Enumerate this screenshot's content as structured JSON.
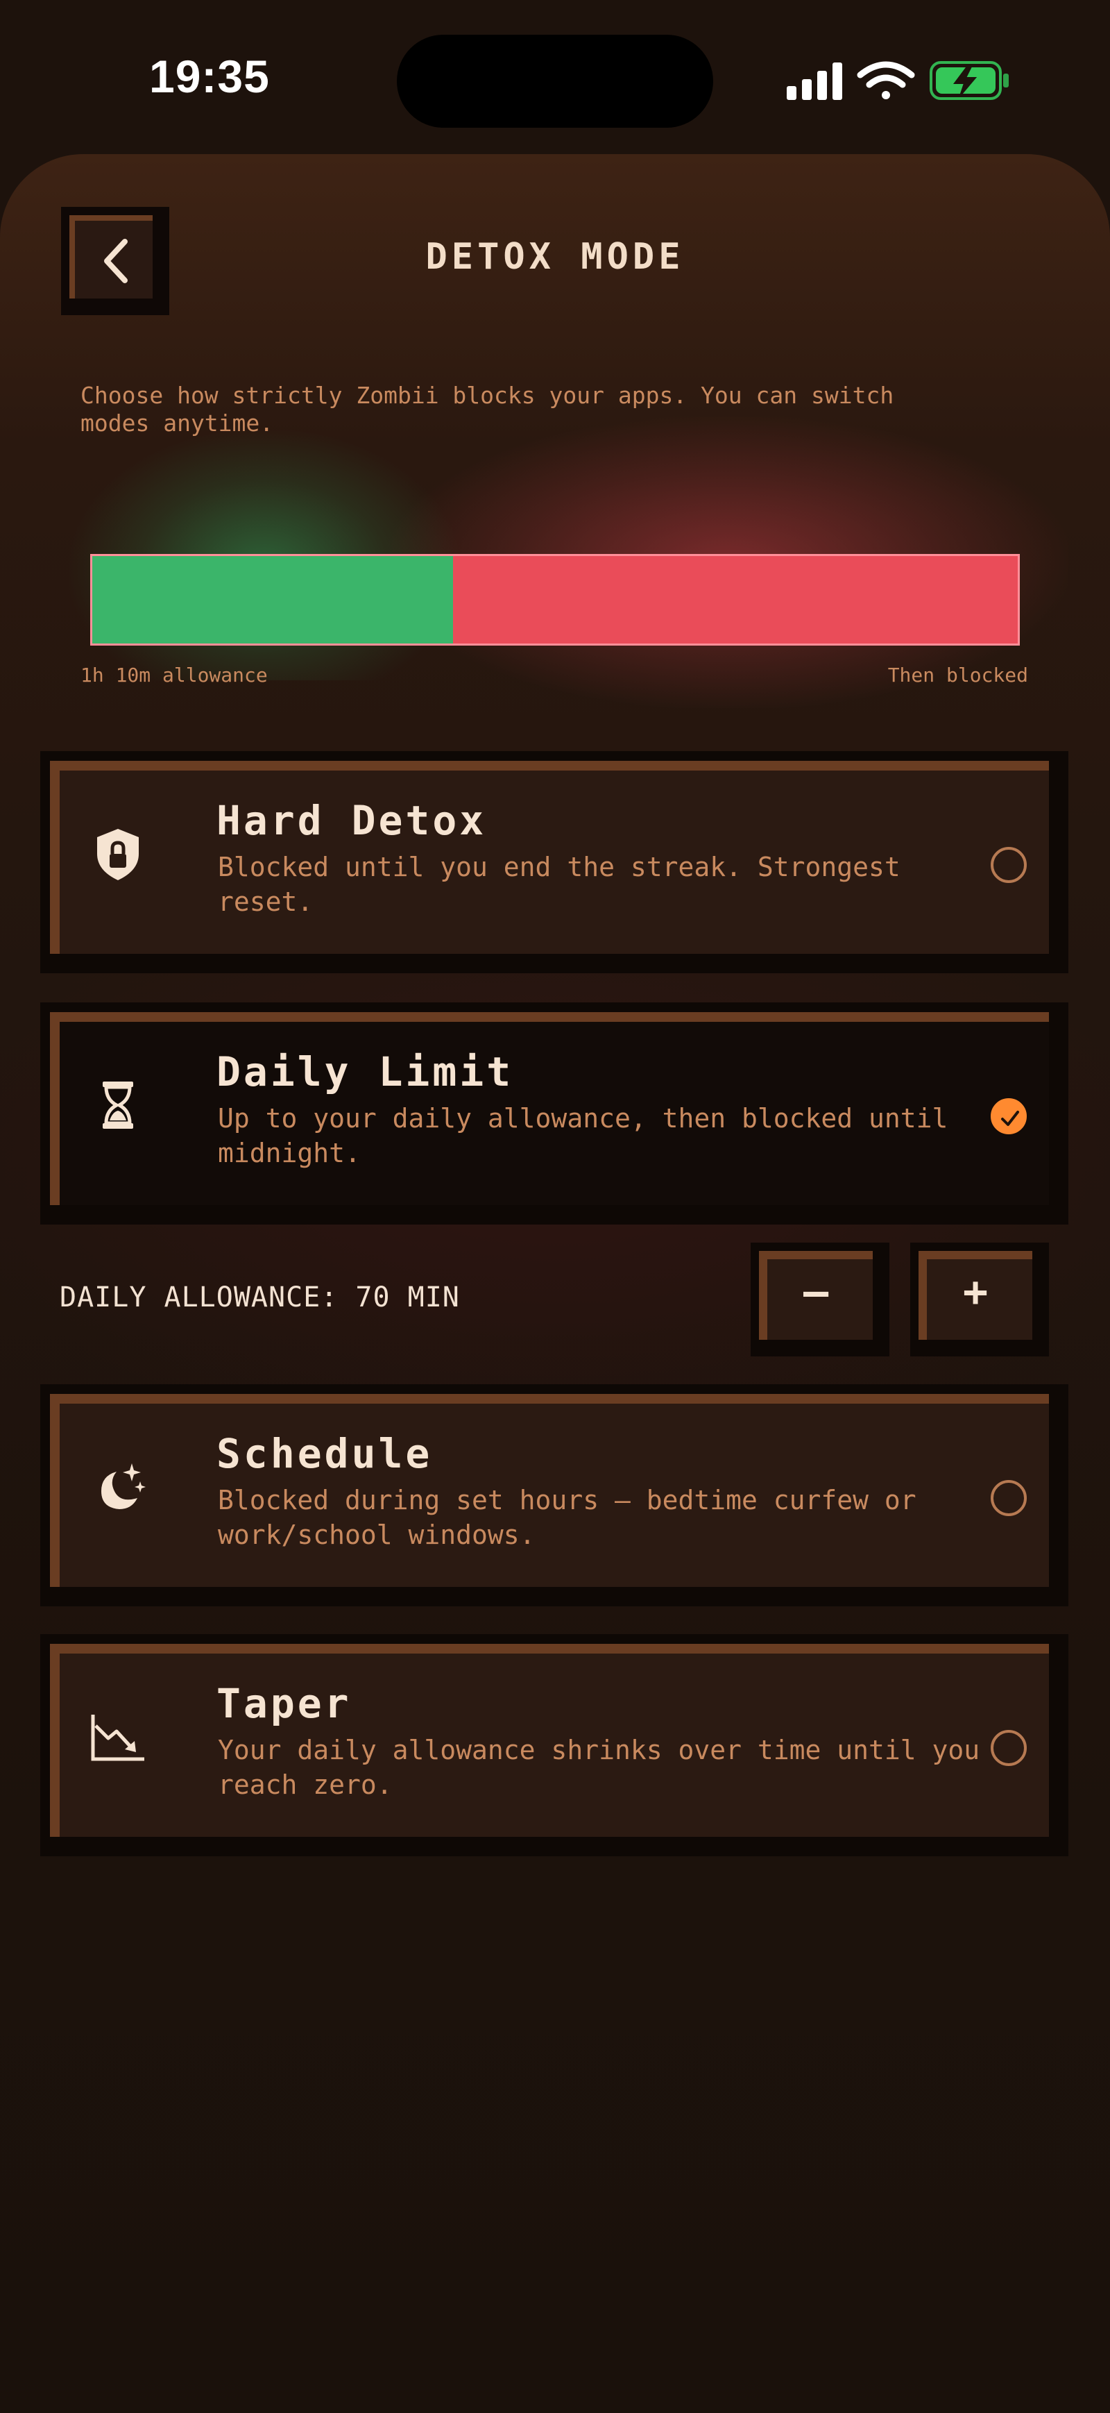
{
  "status_bar": {
    "time": "19:35",
    "icons": [
      "signal-icon",
      "wifi-icon",
      "battery-charging-icon"
    ],
    "battery_color": "#35c759"
  },
  "header": {
    "back_icon": "chevron-left-icon",
    "title": "DETOX MODE"
  },
  "description": "Choose how strictly Zombii blocks your apps. You can switch modes anytime.",
  "allowance_bar": {
    "allowance_fraction": 0.39,
    "left_label": "1h 10m allowance",
    "right_label": "Then blocked",
    "allowed_color": "#3bb56a",
    "blocked_color": "#ea4c59"
  },
  "modes": [
    {
      "icon": "shield-lock-icon",
      "title": "Hard Detox",
      "description": "Blocked until you end the streak. Strongest reset.",
      "selected": false
    },
    {
      "icon": "hourglass-icon",
      "title": "Daily Limit",
      "description": "Up to your daily allowance, then blocked until midnight.",
      "selected": true
    },
    {
      "icon": "moon-stars-icon",
      "title": "Schedule",
      "description": "Blocked during set hours — bedtime curfew or work/school windows.",
      "selected": false
    },
    {
      "icon": "chart-trend-down-icon",
      "title": "Taper",
      "description": "Your daily allowance shrinks over time until you reach zero.",
      "selected": false
    }
  ],
  "daily_allowance": {
    "label": "DAILY ALLOWANCE: 70 MIN",
    "decrement_label": "–",
    "increment_label": "+"
  },
  "colors": {
    "accent": "#ff8a30",
    "background": "#1d120c",
    "card_border": "#6a3d22",
    "text_muted": "#c98a5f"
  }
}
